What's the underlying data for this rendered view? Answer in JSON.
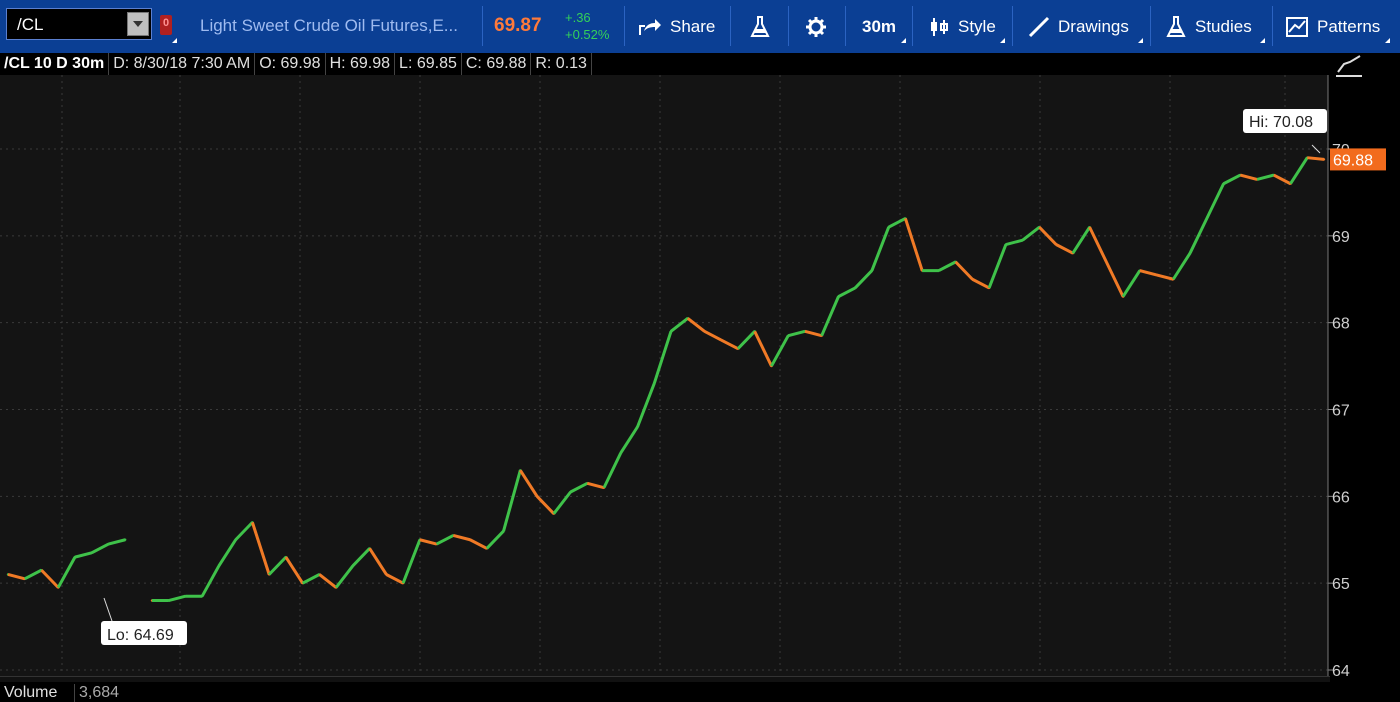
{
  "toolbar": {
    "symbol": "/CL",
    "flag": "0",
    "description": "Light Sweet Crude Oil Futures,E...",
    "last": "69.87",
    "change": "+.36",
    "change_pct": "+0.52%",
    "share_label": "Share",
    "interval_label": "30m",
    "style_label": "Style",
    "drawings_label": "Drawings",
    "studies_label": "Studies",
    "patterns_label": "Patterns"
  },
  "header": {
    "title": "/CL 10 D 30m",
    "date": "D: 8/30/18 7:30 AM",
    "open": "O: 69.98",
    "high": "H: 69.98",
    "low": "L: 69.85",
    "close": "C: 69.88",
    "range": "R: 0.13"
  },
  "volume": {
    "label": "Volume",
    "value": "3,684"
  },
  "colors": {
    "up": "#3fc24a",
    "down": "#f07a26",
    "toolbar": "#0b3f94",
    "price_tag": "#f26b1d"
  },
  "chart_data": {
    "type": "line",
    "title": "",
    "xlabel": "",
    "ylabel": "",
    "ylim": [
      64.0,
      70.9
    ],
    "yticks": [
      64,
      65,
      66,
      67,
      68,
      69,
      70
    ],
    "grid": true,
    "last_price_label": "69.88",
    "hi_label": "Hi: 70.08",
    "lo_label": "Lo: 64.69",
    "series": [
      {
        "values": [
          65.1,
          65.05,
          65.15,
          64.95,
          65.3,
          65.35,
          65.45,
          65.5,
          64.8,
          64.8,
          64.85,
          64.85,
          65.2,
          65.5,
          65.7,
          65.1,
          65.3,
          65.0,
          65.1,
          64.95,
          65.2,
          65.4,
          65.1,
          65.0,
          65.5,
          65.45,
          65.55,
          65.5,
          65.4,
          65.6,
          66.3,
          66.0,
          65.8,
          66.05,
          66.15,
          66.1,
          66.5,
          66.8,
          67.3,
          67.9,
          68.05,
          67.9,
          67.8,
          67.7,
          67.9,
          67.5,
          67.85,
          67.9,
          67.85,
          68.3,
          68.4,
          68.6,
          69.1,
          69.2,
          68.6,
          68.6,
          68.7,
          68.5,
          68.4,
          68.9,
          68.95,
          69.1,
          68.9,
          68.8,
          69.1,
          68.7,
          68.3,
          68.6,
          68.55,
          68.5,
          68.8,
          69.2,
          69.6,
          69.7,
          69.65,
          69.7,
          69.6,
          69.9,
          69.88
        ]
      }
    ]
  }
}
